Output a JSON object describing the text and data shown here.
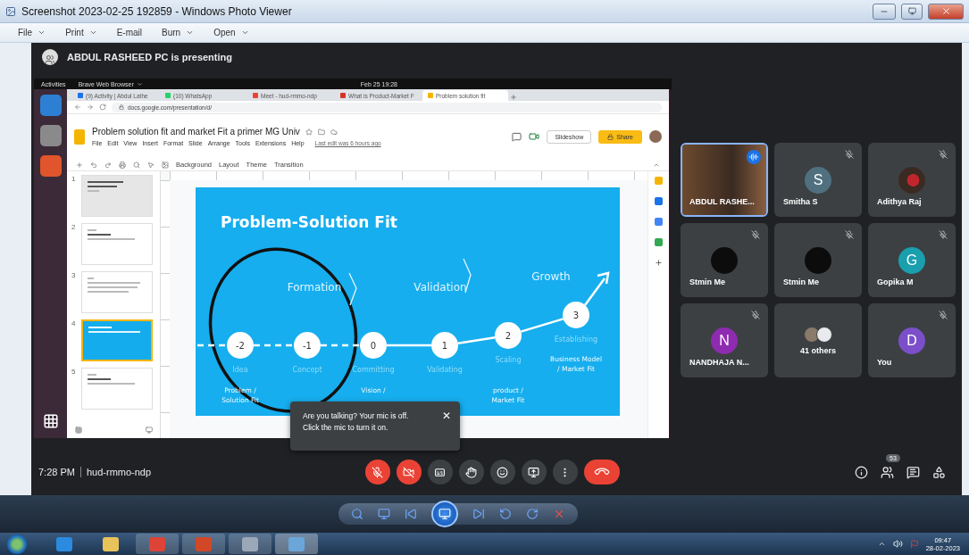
{
  "window": {
    "title": "Screenshot 2023-02-25 192859 - Windows Photo Viewer"
  },
  "menu": [
    {
      "label": "File",
      "dropdown": true
    },
    {
      "label": "Print",
      "dropdown": true
    },
    {
      "label": "E-mail",
      "dropdown": false
    },
    {
      "label": "Burn",
      "dropdown": true
    },
    {
      "label": "Open",
      "dropdown": true
    }
  ],
  "meet": {
    "presenting_banner": "ABDUL RASHEED PC is presenting",
    "desktop": {
      "activities": "Activities",
      "app": "Brave Web Browser",
      "clock": "Feb 25  19:28"
    },
    "browser": {
      "tabs": [
        {
          "label": "(9) Activity | Abdul Lathe",
          "selected": false
        },
        {
          "label": "(10) WhatsApp",
          "selected": false
        },
        {
          "label": "Meet - hud-rmmo-ndp",
          "selected": false
        },
        {
          "label": "What is Product-Market F",
          "selected": false
        },
        {
          "label": "Problem solution fit",
          "selected": true
        }
      ],
      "url": "docs.google.com/presentation/d/"
    },
    "docs": {
      "title": "Problem solution fit and market Fit a primer MG Univ",
      "menu": [
        "File",
        "Edit",
        "View",
        "Insert",
        "Format",
        "Slide",
        "Arrange",
        "Tools",
        "Extensions",
        "Help"
      ],
      "last_edit": "Last edit was 6 hours ago",
      "toolbar": [
        "Background",
        "Layout",
        "Theme",
        "Transition"
      ],
      "slideshow": "Slideshow",
      "share": "Share"
    },
    "slides": [
      {
        "number": "1",
        "kind": "title",
        "selected": false
      },
      {
        "number": "2",
        "kind": "heading",
        "selected": false
      },
      {
        "number": "3",
        "kind": "text",
        "selected": false
      },
      {
        "number": "4",
        "kind": "diagram",
        "selected": true
      },
      {
        "number": "5",
        "kind": "heading",
        "selected": false
      }
    ],
    "slide": {
      "title": "Problem-Solution Fit",
      "phases": [
        "Formation",
        "Validation",
        "Growth"
      ],
      "steps": [
        {
          "value": "-2",
          "label": "Idea",
          "dashed": true,
          "note": [
            "Problem /",
            "Solution Fit"
          ]
        },
        {
          "value": "-1",
          "label": "Concept",
          "dashed": true
        },
        {
          "value": "0",
          "label": "Committing",
          "dashed": true,
          "note": [
            "Vision /"
          ]
        },
        {
          "value": "1",
          "label": "Validating",
          "dashed": false
        },
        {
          "value": "2",
          "label": "Scaling",
          "dashed": false,
          "note": [
            "product /",
            "Market Fit"
          ]
        },
        {
          "value": "3",
          "label": "Establishing",
          "dashed": false,
          "note": [
            "Business Model",
            "/ Market Fit"
          ]
        }
      ]
    },
    "tooltip": {
      "lines": [
        "Are you talking? Your mic is off.",
        "Click the mic to turn it on."
      ],
      "close": "✕"
    },
    "participants": [
      {
        "name": "ABDUL RASHE...",
        "kind": "video",
        "muted": false,
        "speaking": true
      },
      {
        "name": "Smitha S",
        "kind": "letter",
        "letter": "S",
        "color": "#50707f",
        "muted": true,
        "speaking": false
      },
      {
        "name": "Adithya Raj",
        "kind": "photo",
        "muted": true,
        "speaking": false
      },
      {
        "name": "Stmin Me",
        "kind": "dark",
        "muted": true,
        "speaking": false
      },
      {
        "name": "Stmin Me",
        "kind": "dark",
        "muted": true,
        "speaking": false
      },
      {
        "name": "Gopika M",
        "kind": "letter",
        "letter": "G",
        "color": "#1a9fae",
        "muted": true,
        "speaking": false
      },
      {
        "name": "NANDHAJA N...",
        "kind": "letter",
        "letter": "N",
        "color": "#8e2bb0",
        "muted": true,
        "speaking": false
      },
      {
        "name": "41 others",
        "kind": "group",
        "muted": false,
        "speaking": false
      },
      {
        "name": "You",
        "kind": "letter",
        "letter": "D",
        "color": "#7b4fc9",
        "muted": true,
        "speaking": false
      }
    ],
    "time": "7:28 PM",
    "meeting_code": "hud-rmmo-ndp",
    "controls": [
      {
        "kind": "mic",
        "on": false
      },
      {
        "kind": "camera",
        "on": false
      },
      {
        "kind": "captions"
      },
      {
        "kind": "hand"
      },
      {
        "kind": "emoji"
      },
      {
        "kind": "present"
      },
      {
        "kind": "more"
      },
      {
        "kind": "hangup"
      }
    ],
    "people_count": "53"
  },
  "taskbar": {
    "time": "09:47",
    "date": "28-02-2023"
  }
}
